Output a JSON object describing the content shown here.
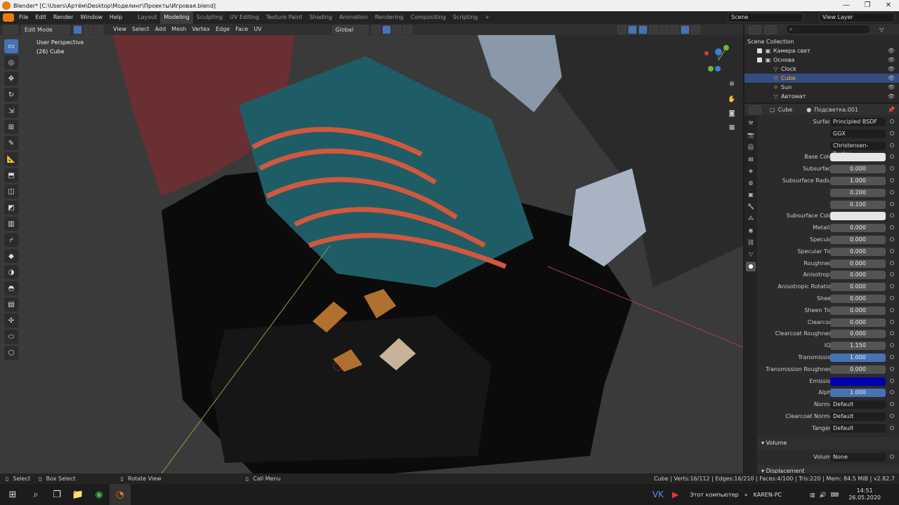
{
  "titlebar": {
    "title": "Blender* [C:\\Users\\Артём\\Desktop\\Моделинг\\Проекты\\Игровая.blend]",
    "minimize": "—",
    "maximize": "❐",
    "close": "✕"
  },
  "menu": [
    "File",
    "Edit",
    "Render",
    "Window",
    "Help"
  ],
  "workspaces": [
    "Layout",
    "Modeling",
    "Sculpting",
    "UV Editing",
    "Texture Paint",
    "Shading",
    "Animation",
    "Rendering",
    "Compositing",
    "Scripting",
    "+"
  ],
  "scene": {
    "scene_label": "Scene",
    "view_layer_label": "View Layer"
  },
  "viewport_header": {
    "mode": "Edit Mode",
    "menus": [
      "View",
      "Select",
      "Add",
      "Mesh",
      "Vertex",
      "Edge",
      "Face",
      "UV"
    ],
    "orientation": "Global"
  },
  "viewport": {
    "perspective": "User Perspective",
    "object": "(26) Cube"
  },
  "toolbar_icons": [
    "select-box-icon",
    "cursor-icon",
    "move-icon",
    "rotate-icon",
    "scale-icon",
    "transform-icon",
    "annotate-icon",
    "measure-icon",
    "extrude-icon",
    "inset-icon",
    "bevel-icon",
    "loop-cut-icon",
    "knife-icon",
    "poly-build-icon",
    "spin-icon",
    "smooth-icon",
    "edge-slide-icon",
    "shrink-icon",
    "shear-icon",
    "rip-icon"
  ],
  "outliner": {
    "root": "Scene Collection",
    "items": [
      {
        "label": "Камера свет",
        "depth": 1,
        "icon": "collection-icon"
      },
      {
        "label": "Основа",
        "depth": 1,
        "icon": "collection-icon"
      },
      {
        "label": "Clock",
        "depth": 2,
        "icon": "mesh-icon"
      },
      {
        "label": "Cube",
        "depth": 2,
        "icon": "mesh-icon",
        "selected": true
      },
      {
        "label": "Sun",
        "depth": 2,
        "icon": "light-icon"
      },
      {
        "label": "Автомат",
        "depth": 2,
        "icon": "mesh-icon"
      }
    ]
  },
  "properties": {
    "object": "Cube",
    "material": "Подсветка.001",
    "rows": [
      {
        "label": "Surface",
        "value": "Principled BSDF",
        "style": "dark"
      },
      {
        "label": "",
        "value": "GGX",
        "style": "dark"
      },
      {
        "label": "",
        "value": "Christensen-Burley",
        "style": "dark"
      },
      {
        "label": "Base Color",
        "value": "",
        "style": "white"
      },
      {
        "label": "Subsurface",
        "value": "0.000"
      },
      {
        "label": "Subsurface Radius",
        "value": "1.000"
      },
      {
        "label": "",
        "value": "0.200"
      },
      {
        "label": "",
        "value": "0.100"
      },
      {
        "label": "Subsurface Color",
        "value": "",
        "style": "white"
      },
      {
        "label": "Metallic",
        "value": "0.000"
      },
      {
        "label": "Specular",
        "value": "0.000"
      },
      {
        "label": "Specular Tint",
        "value": "0.000"
      },
      {
        "label": "Roughness",
        "value": "0.000"
      },
      {
        "label": "Anisotropic",
        "value": "0.000"
      },
      {
        "label": "Anisotropic Rotation",
        "value": "0.000"
      },
      {
        "label": "Sheen",
        "value": "0.000"
      },
      {
        "label": "Sheen Tint",
        "value": "0.000"
      },
      {
        "label": "Clearcoat",
        "value": "0.000"
      },
      {
        "label": "Clearcoat Roughness",
        "value": "0.000"
      },
      {
        "label": "IOR",
        "value": "1.150"
      },
      {
        "label": "Transmission",
        "value": "1.000",
        "style": "blue"
      },
      {
        "label": "Transmission Roughness",
        "value": "0.000"
      },
      {
        "label": "Emission",
        "value": "",
        "style": "emission"
      },
      {
        "label": "Alpha",
        "value": "1.000",
        "style": "blue"
      },
      {
        "label": "Normal",
        "value": "Default",
        "style": "dark"
      },
      {
        "label": "Clearcoat Normal",
        "value": "Default",
        "style": "dark"
      },
      {
        "label": "Tangent",
        "value": "Default",
        "style": "dark"
      }
    ],
    "volume_section": "Volume",
    "volume_label": "Volume",
    "volume_value": "None",
    "displacement_section": "Displacement"
  },
  "statusbar": {
    "select": "Select",
    "box_select": "Box Select",
    "rotate_view": "Rotate View",
    "call_menu": "Call Menu",
    "stats": "Cube | Verts:16/112 | Edges:16/210 | Faces:4/100 | Tris:220 | Mem: 84.5 MiB | v2.82.7"
  },
  "taskbar": {
    "pc_label": "Этот компьютер",
    "user": "KAREN-PC",
    "time": "14:51",
    "date": "26.05.2020"
  },
  "colors": {
    "emission": "#0000b0",
    "selection": "#4772b3",
    "accent": "#e87d0d"
  }
}
